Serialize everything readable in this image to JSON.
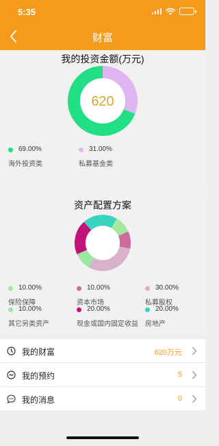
{
  "status_bar": {
    "time": "5:35"
  },
  "nav": {
    "title": "财富",
    "back_icon": "chevron-left-icon"
  },
  "investment": {
    "title": "我的投资金额(万元)",
    "total": "620",
    "total_color": "#d9a531",
    "segments": [
      {
        "label": "海外投资类",
        "percent_text": "69.00%",
        "value": 69,
        "color": "#22df85"
      },
      {
        "label": "私募基金类",
        "percent_text": "31.00%",
        "value": 31,
        "color": "#dfb5f1"
      }
    ]
  },
  "allocation": {
    "title": "资产配置方案",
    "segments": [
      {
        "label": "保险保障",
        "percent_text": "10.00%",
        "value": 10,
        "color": "#a5e8a0"
      },
      {
        "label": "资本市场",
        "percent_text": "10.00%",
        "value": 10,
        "color": "#cf6a9d"
      },
      {
        "label": "私募股权",
        "percent_text": "30.00%",
        "value": 30,
        "color": "#d9b1cb"
      },
      {
        "label": "其它另类资产",
        "percent_text": "10.00%",
        "value": 10,
        "color": "#99e9a5"
      },
      {
        "label": "现金或国内固定收益",
        "percent_text": "20.00%",
        "value": 20,
        "color": "#c2137a"
      },
      {
        "label": "房地产",
        "percent_text": "20.00%",
        "value": 20,
        "color": "#3ad3c0"
      }
    ]
  },
  "menu": [
    {
      "icon": "clock-icon",
      "label": "我的财富",
      "value": "620万元"
    },
    {
      "icon": "calendar-icon",
      "label": "我的预约",
      "value": "5"
    },
    {
      "icon": "message-icon",
      "label": "我的消息",
      "value": "0"
    }
  ],
  "colors": {
    "brand": "#f59a1b",
    "accent_value": "#f59a1b"
  }
}
